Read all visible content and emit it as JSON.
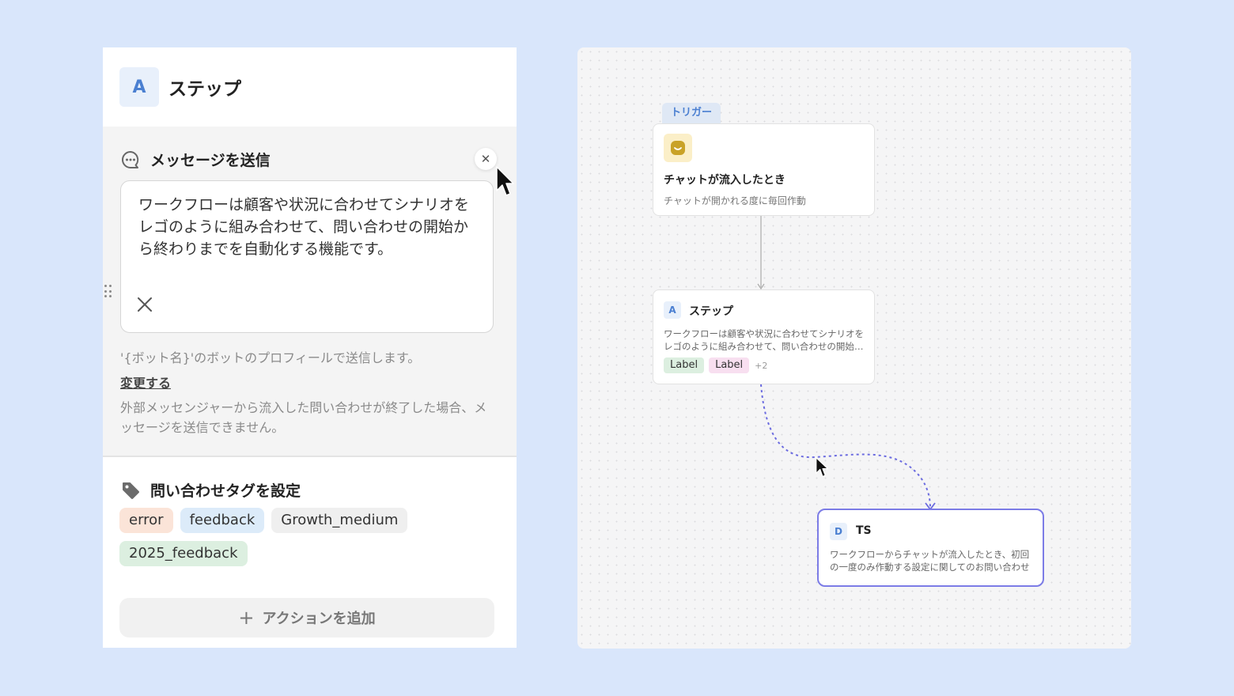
{
  "panel": {
    "badge_letter": "A",
    "title": "ステップ",
    "message": {
      "title": "メッセージを送信",
      "body": "ワークフローは顧客や状況に合わせてシナリオをレゴのように組み合わせて、問い合わせの開始から終わりまでを自動化する機能です。",
      "close_symbol": "✕",
      "note": "'{ボット名}'のボットのプロフィールで送信します。",
      "change_link": "変更する",
      "warning": "外部メッセンジャーから流入した問い合わせが終了した場合、メッセージを送信できません。"
    },
    "tags": {
      "title": "問い合わせタグを設定",
      "chips": [
        {
          "label": "error",
          "color": "#fbe4d8"
        },
        {
          "label": "feedback",
          "color": "#dcebf9"
        },
        {
          "label": "Growth_medium",
          "color": "#efefef"
        },
        {
          "label": "2025_feedback",
          "color": "#dcefe0"
        }
      ]
    },
    "add_action": {
      "plus": "+",
      "label": "アクションを追加"
    }
  },
  "canvas": {
    "trigger_tab": "トリガー",
    "trigger_node": {
      "title": "チャットが流入したとき",
      "desc": "チャットが開かれる度に毎回作動"
    },
    "step_node": {
      "badge": "A",
      "title": "ステップ",
      "desc": "ワークフローは顧客や状況に合わせてシナリオをレゴのように組み合わせて、問い合わせの開始から終わりまでを自動化する機能です。",
      "labels": [
        {
          "text": "Label",
          "color": "#dcefe0"
        },
        {
          "text": "Label",
          "color": "#f8dff0"
        }
      ],
      "more": "+2"
    },
    "ts_node": {
      "badge": "D",
      "title": "TS",
      "desc": "ワークフローからチャットが流入したとき、初回の一度のみ作動する設定に関してのお問い合わせ"
    }
  },
  "colors": {
    "background": "#d9e6fb",
    "accent_blue": "#4a7fd1",
    "selected_border": "#7c7ce6",
    "dashed_connector": "#6b6be0"
  }
}
